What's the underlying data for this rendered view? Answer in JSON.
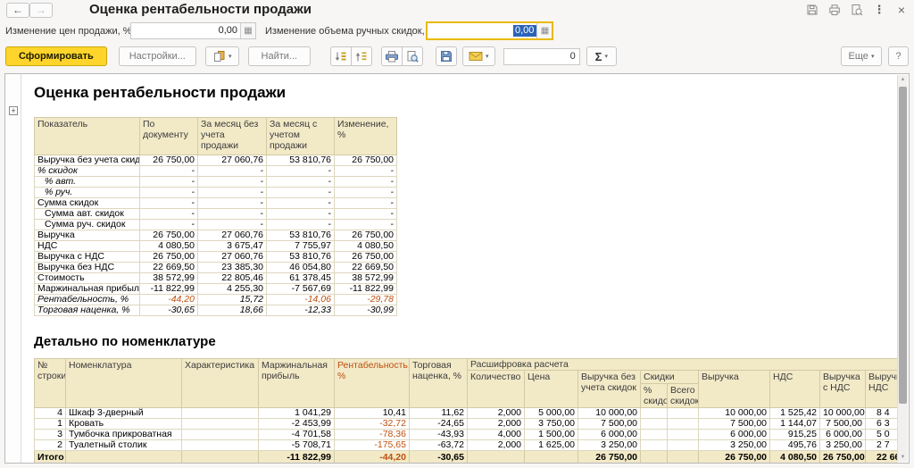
{
  "window": {
    "title": "Оценка рентабельности продажи"
  },
  "icons": {
    "back": "←",
    "forward": "→",
    "more": "⋮",
    "close": "×",
    "dropdown": "▾",
    "calculator": "▦",
    "expander": "+",
    "scroll_up": "▲",
    "scroll_down": "▼"
  },
  "params": {
    "price_change": {
      "label": "Изменение цен продажи, %:",
      "value": "0,00"
    },
    "discount_change": {
      "label": "Изменение объема ручных скидок, %:",
      "value": "0,00"
    }
  },
  "toolbar": {
    "generate_label": "Сформировать",
    "settings_label": "Настройки...",
    "find_label": "Найти...",
    "counter_value": "0",
    "sigma_label": "Σ",
    "more_label": "Еще",
    "help_label": "?"
  },
  "report": {
    "title": "Оценка рентабельности продажи",
    "summary_table": {
      "headers": [
        "Показатель",
        "По документу",
        "За месяц без учета продажи",
        "За месяц с учетом продажи",
        "Изменение, %"
      ],
      "rows": [
        {
          "label": "Выручка без учета скидок",
          "values": [
            "26 750,00",
            "27 060,76",
            "53 810,76",
            "26 750,00"
          ]
        },
        {
          "label": "% скидок",
          "italic": true,
          "values": [
            "-",
            "-",
            "-",
            "-"
          ]
        },
        {
          "label": "% авт.",
          "italic": true,
          "indent": 1,
          "values": [
            "-",
            "-",
            "-",
            "-"
          ]
        },
        {
          "label": "% руч.",
          "italic": true,
          "indent": 1,
          "values": [
            "-",
            "-",
            "-",
            "-"
          ]
        },
        {
          "label": "Сумма скидок",
          "values": [
            "-",
            "-",
            "-",
            "-"
          ]
        },
        {
          "label": "Сумма авт. скидок",
          "indent": 1,
          "values": [
            "-",
            "-",
            "-",
            "-"
          ]
        },
        {
          "label": "Сумма руч. скидок",
          "indent": 1,
          "values": [
            "-",
            "-",
            "-",
            "-"
          ]
        },
        {
          "label": "Выручка",
          "values": [
            "26 750,00",
            "27 060,76",
            "53 810,76",
            "26 750,00"
          ]
        },
        {
          "label": "НДС",
          "values": [
            "4 080,50",
            "3 675,47",
            "7 755,97",
            "4 080,50"
          ]
        },
        {
          "label": "Выручка с НДС",
          "values": [
            "26 750,00",
            "27 060,76",
            "53 810,76",
            "26 750,00"
          ]
        },
        {
          "label": "Выручка без НДС",
          "values": [
            "22 669,50",
            "23 385,30",
            "46 054,80",
            "22 669,50"
          ]
        },
        {
          "label": "Стоимость",
          "values": [
            "38 572,99",
            "22 805,46",
            "61 378,45",
            "38 572,99"
          ]
        },
        {
          "label": "Маржинальная прибыль",
          "values": [
            "-11 822,99",
            "4 255,30",
            "-7 567,69",
            "-11 822,99"
          ]
        },
        {
          "label": "Рентабельность, %",
          "italic": true,
          "red": true,
          "values": [
            "-44,20",
            "15,72",
            "-14,06",
            "-29,78"
          ]
        },
        {
          "label": "Торговая наценка, %",
          "italic": true,
          "values": [
            "-30,65",
            "18,66",
            "-12,33",
            "-30,99"
          ]
        }
      ]
    },
    "detail_title": "Детально по номенклатуре",
    "detail_table": {
      "headers": {
        "row_num": "№ строки",
        "nomenclature": "Номенклатура",
        "characteristic": "Характеристика",
        "margin": "Маржинальная прибыль",
        "profitability": "Рентабельность, %",
        "markup": "Торговая наценка, %",
        "calc_group": "Расшифровка расчета",
        "qty": "Количество",
        "price": "Цена",
        "rev_no_disc": "Выручка без учета скидок",
        "discounts": "Скидки",
        "disc_pct": "% скидок",
        "disc_total": "Всего скидок",
        "revenue": "Выручка",
        "vat": "НДС",
        "rev_with_vat": "Выручка с НДС",
        "rev_no_vat": "Выручка без НДС"
      },
      "rows": [
        [
          "4",
          "Шкаф 3-дверный",
          "",
          "1 041,29",
          "10,41",
          "11,62",
          "2,000",
          "5 000,00",
          "10 000,00",
          "",
          "",
          "10 000,00",
          "1 525,42",
          "10 000,00",
          "8 4"
        ],
        [
          "1",
          "Кровать",
          "",
          "-2 453,99",
          "-32,72",
          "-24,65",
          "2,000",
          "3 750,00",
          "7 500,00",
          "",
          "",
          "7 500,00",
          "1 144,07",
          "7 500,00",
          "6 3"
        ],
        [
          "3",
          "Тумбочка прикроватная",
          "",
          "-4 701,58",
          "-78,36",
          "-43,93",
          "4,000",
          "1 500,00",
          "6 000,00",
          "",
          "",
          "6 000,00",
          "915,25",
          "6 000,00",
          "5 0"
        ],
        [
          "2",
          "Туалетный столик",
          "",
          "-5 708,71",
          "-175,65",
          "-63,72",
          "2,000",
          "1 625,00",
          "3 250,00",
          "",
          "",
          "3 250,00",
          "495,76",
          "3 250,00",
          "2 7"
        ]
      ],
      "total_row": [
        "Итого",
        "",
        "",
        "-11 822,99",
        "-44,20",
        "-30,65",
        "",
        "",
        "26 750,00",
        "",
        "",
        "26 750,00",
        "4 080,50",
        "26 750,00",
        "22 66"
      ]
    }
  }
}
